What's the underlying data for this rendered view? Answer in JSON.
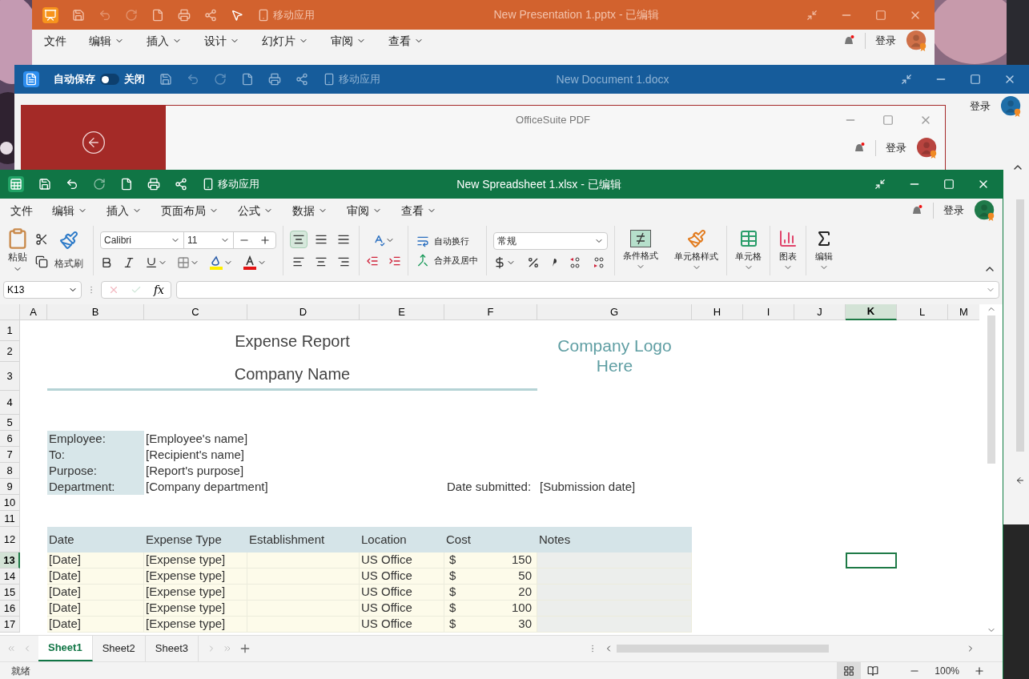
{
  "presentation_window": {
    "title": "New Presentation 1.pptx - 已编辑",
    "mobile_label": "移动应用",
    "menu": [
      "文件",
      "编辑",
      "插入",
      "设计",
      "幻灯片",
      "审阅",
      "查看"
    ],
    "login": "登录"
  },
  "document_window": {
    "title": "New Document 1.docx",
    "autosave_label": "自动保存",
    "autosave_on": false,
    "autosave_state": "关闭",
    "mobile_label": "移动应用",
    "login": "登录"
  },
  "pdf_window": {
    "title": "OfficeSuite PDF",
    "login": "登录"
  },
  "spreadsheet_window": {
    "title": "New Spreadsheet 1.xlsx - 已编辑",
    "mobile_label": "移动应用",
    "login": "登录",
    "menu": [
      {
        "label": "文件",
        "has_menu": false
      },
      {
        "label": "编辑",
        "has_menu": true
      },
      {
        "label": "插入",
        "has_menu": true
      },
      {
        "label": "页面布局",
        "has_menu": true
      },
      {
        "label": "公式",
        "has_menu": true
      },
      {
        "label": "数据",
        "has_menu": true
      },
      {
        "label": "审阅",
        "has_menu": true
      },
      {
        "label": "查看",
        "has_menu": true
      }
    ],
    "ribbon": {
      "paste": "粘贴",
      "format_painter": "格式刷",
      "font": "Calibri",
      "font_size": "11",
      "wrap_text": "自动换行",
      "merge_center": "合并及居中",
      "number_format": "常规",
      "conditional_format": "条件格式",
      "cell_styles": "单元格样式",
      "cells": "单元格",
      "chart": "图表",
      "editing": "编辑"
    },
    "name_box": "K13",
    "function_label": "fx",
    "columns": [
      {
        "label": "A",
        "selected": false
      },
      {
        "label": "B",
        "selected": false
      },
      {
        "label": "C",
        "selected": false
      },
      {
        "label": "D",
        "selected": false
      },
      {
        "label": "E",
        "selected": false
      },
      {
        "label": "F",
        "selected": false
      },
      {
        "label": "G",
        "selected": false
      },
      {
        "label": "H",
        "selected": false
      },
      {
        "label": "I",
        "selected": false
      },
      {
        "label": "J",
        "selected": false
      },
      {
        "label": "K",
        "selected": true
      },
      {
        "label": "L",
        "selected": false
      },
      {
        "label": "M",
        "selected": false
      }
    ],
    "rows": [
      {
        "label": "1",
        "selected": false
      },
      {
        "label": "2",
        "selected": false
      },
      {
        "label": "3",
        "selected": false
      },
      {
        "label": "4",
        "selected": false
      },
      {
        "label": "5",
        "selected": false
      },
      {
        "label": "6",
        "selected": false
      },
      {
        "label": "7",
        "selected": false
      },
      {
        "label": "8",
        "selected": false
      },
      {
        "label": "9",
        "selected": false
      },
      {
        "label": "10",
        "selected": false
      },
      {
        "label": "11",
        "selected": false
      },
      {
        "label": "12",
        "selected": false
      },
      {
        "label": "13",
        "selected": true
      },
      {
        "label": "14",
        "selected": false
      },
      {
        "label": "15",
        "selected": false
      },
      {
        "label": "16",
        "selected": false
      },
      {
        "label": "17",
        "selected": false
      }
    ],
    "sheet": {
      "title": "Expense Report",
      "company": "Company Name",
      "logo": "Company Logo Here",
      "info": [
        {
          "label": "Employee:",
          "value": "[Employee's name]"
        },
        {
          "label": "To:",
          "value": "[Recipient's name]"
        },
        {
          "label": "Purpose:",
          "value": "[Report's purpose]"
        },
        {
          "label": "Department:",
          "value": "[Company department]"
        }
      ],
      "date_submitted": {
        "label": "Date submitted:",
        "value": "[Submission date]"
      },
      "table": {
        "columns": [
          "Date",
          "Expense Type",
          "Establishment",
          "Location",
          "Cost",
          "Notes"
        ],
        "rows": [
          {
            "date": "[Date]",
            "type": "[Expense type]",
            "location": "US Office",
            "currency": "$",
            "cost": "150"
          },
          {
            "date": "[Date]",
            "type": "[Expense type]",
            "location": "US Office",
            "currency": "$",
            "cost": "50"
          },
          {
            "date": "[Date]",
            "type": "[Expense type]",
            "location": "US Office",
            "currency": "$",
            "cost": "20"
          },
          {
            "date": "[Date]",
            "type": "[Expense type]",
            "location": "US Office",
            "currency": "$",
            "cost": "100"
          },
          {
            "date": "[Date]",
            "type": "[Expense type]",
            "location": "US Office",
            "currency": "$",
            "cost": "30"
          }
        ]
      }
    },
    "sheet_tabs": [
      {
        "label": "Sheet1",
        "selected": true
      },
      {
        "label": "Sheet2",
        "selected": false
      },
      {
        "label": "Sheet3",
        "selected": false
      }
    ],
    "status": "就绪",
    "zoom": "100%"
  }
}
